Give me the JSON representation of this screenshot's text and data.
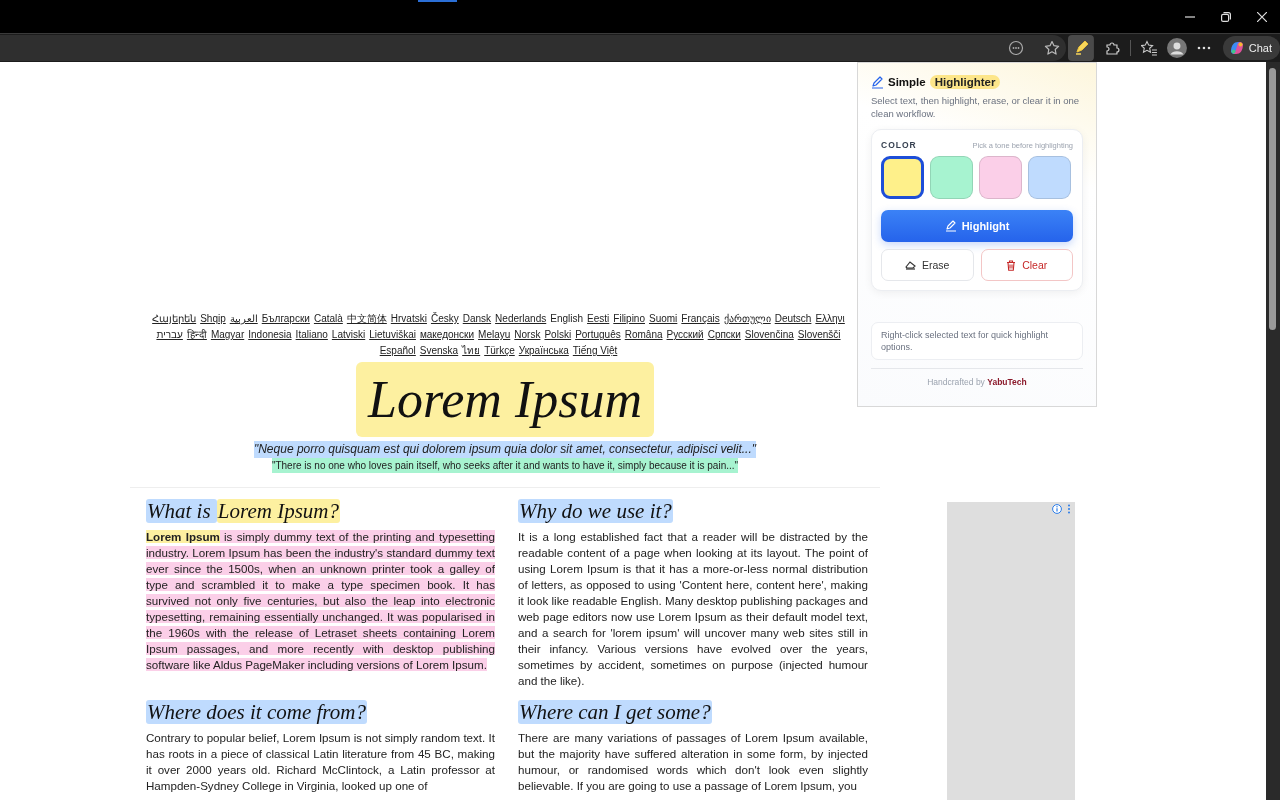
{
  "browser": {
    "chat_button": "Chat"
  },
  "languages": [
    [
      {
        "label": "Հայերեն",
        "selected": false
      },
      {
        "label": "Shqip",
        "selected": false
      },
      {
        "label": "العربية",
        "selected": false
      },
      {
        "label": "Български",
        "selected": false
      },
      {
        "label": "Català",
        "selected": false
      },
      {
        "label": "中文简体",
        "selected": false
      },
      {
        "label": "Hrvatski",
        "selected": false
      },
      {
        "label": "Česky",
        "selected": false
      },
      {
        "label": "Dansk",
        "selected": false
      },
      {
        "label": "Nederlands",
        "selected": false
      },
      {
        "label": "English",
        "selected": true
      },
      {
        "label": "Eesti",
        "selected": false
      },
      {
        "label": "Filipino",
        "selected": false
      },
      {
        "label": "Suomi",
        "selected": false
      },
      {
        "label": "Français",
        "selected": false
      },
      {
        "label": "ქართული",
        "selected": false
      },
      {
        "label": "Deutsch",
        "selected": false
      },
      {
        "label": "Ελληνι",
        "selected": false
      }
    ],
    [
      {
        "label": "עברית",
        "selected": false
      },
      {
        "label": "हिन्दी",
        "selected": false
      },
      {
        "label": "Magyar",
        "selected": false
      },
      {
        "label": "Indonesia",
        "selected": false
      },
      {
        "label": "Italiano",
        "selected": false
      },
      {
        "label": "Latviski",
        "selected": false
      },
      {
        "label": "Lietuviškai",
        "selected": false
      },
      {
        "label": "македонски",
        "selected": false
      },
      {
        "label": "Melayu",
        "selected": false
      },
      {
        "label": "Norsk",
        "selected": false
      },
      {
        "label": "Polski",
        "selected": false
      },
      {
        "label": "Português",
        "selected": false
      },
      {
        "label": "Româna",
        "selected": false
      },
      {
        "label": "Русский",
        "selected": false
      },
      {
        "label": "Српски",
        "selected": false
      },
      {
        "label": "Slovenčina",
        "selected": false
      },
      {
        "label": "Slovenšči",
        "selected": false
      }
    ],
    [
      {
        "label": "Español",
        "selected": false
      },
      {
        "label": "Svenska",
        "selected": false
      },
      {
        "label": "ไทย",
        "selected": false
      },
      {
        "label": "Türkçe",
        "selected": false
      },
      {
        "label": "Українська",
        "selected": false
      },
      {
        "label": "Tiếng Việt",
        "selected": false
      }
    ]
  ],
  "title": {
    "text": "Lorem Ipsum",
    "color": "#fdf0a0"
  },
  "quotes": [
    {
      "text": "\"Neque porro quisquam est qui dolorem ipsum quia dolor sit amet, consectetur, adipisci velit...\"",
      "color": "#bfdbfe",
      "italic": true
    },
    {
      "text": "\"There is no one who loves pain itself, who seeks after it and wants to have it, simply because it is pain...\"",
      "color": "#a7f3d0",
      "italic": false
    }
  ],
  "sections": [
    {
      "heading": [
        {
          "text": "What is ",
          "color": "#bfdbfe"
        },
        {
          "text": "Lorem Ipsum?",
          "color": "#fdf0a0"
        }
      ],
      "body": [
        {
          "text": "Lorem Ipsum",
          "color": "#fdf0a0",
          "bold": true
        },
        {
          "text": " is simply dummy text of the printing and typesetting industry. Lorem Ipsum has been the industry's standard dummy text ever since the 1500s, when an unknown printer took a galley of type and scrambled it to make a type specimen book. It has survived not only five centuries, but also the leap into electronic typesetting, remaining essentially unchanged. It was popularised in the 1960s with the release of Letraset sheets containing Lorem Ipsum passages, and more recently with desktop publishing software like Aldus PageMaker including versions of Lorem Ipsum.",
          "color": "#fbcfe8",
          "bold": false
        }
      ]
    },
    {
      "heading": [
        {
          "text": "Why do we use it?",
          "color": "#bfdbfe"
        }
      ],
      "body": [
        {
          "text": "It is a long established fact that a reader will be distracted by the readable content of a page when looking at its layout. The point of using Lorem Ipsum is that it has a more-or-less normal distribution of letters, as opposed to using 'Content here, content here', making it look like readable English. Many desktop publishing packages and web page editors now use Lorem Ipsum as their default model text, and a search for 'lorem ipsum' will uncover many web sites still in their infancy. Various versions have evolved over the years, sometimes by accident, sometimes on purpose (injected humour and the like).",
          "bold": false
        }
      ]
    },
    {
      "heading": [
        {
          "text": "Where does it come from?",
          "color": "#bfdbfe"
        }
      ],
      "body": [
        {
          "text": "Contrary to popular belief, Lorem Ipsum is not simply random text. It has roots in a piece of classical Latin literature from 45 BC, making it over 2000 years old. Richard McClintock, a Latin professor at Hampden-Sydney College in Virginia, looked up one of",
          "bold": false
        }
      ]
    },
    {
      "heading": [
        {
          "text": "Where can I get some?",
          "color": "#bfdbfe"
        }
      ],
      "body": [
        {
          "text": "There are many variations of passages of Lorem Ipsum available, but the majority have suffered alteration in some form, by injected humour, or randomised words which don't look even slightly believable. If you are going to use a passage of Lorem Ipsum, you",
          "bold": false
        }
      ]
    }
  ],
  "popup": {
    "title": "Simple",
    "badge": "Highlighter",
    "description": "Select text, then highlight, erase, or clear it in one clean workflow.",
    "color_label": "COLOR",
    "color_hint": "Pick a tone before highlighting",
    "swatches": [
      {
        "color": "#fef08a",
        "selected": true
      },
      {
        "color": "#a7f3d0",
        "selected": false
      },
      {
        "color": "#fbcfe8",
        "selected": false
      },
      {
        "color": "#bfdbfe",
        "selected": false
      }
    ],
    "highlight_button": "Highlight",
    "erase_button": "Erase",
    "clear_button": "Clear",
    "tip": "Right-click selected text for quick highlight options.",
    "footer": "Handcrafted by **YabuTech**"
  }
}
